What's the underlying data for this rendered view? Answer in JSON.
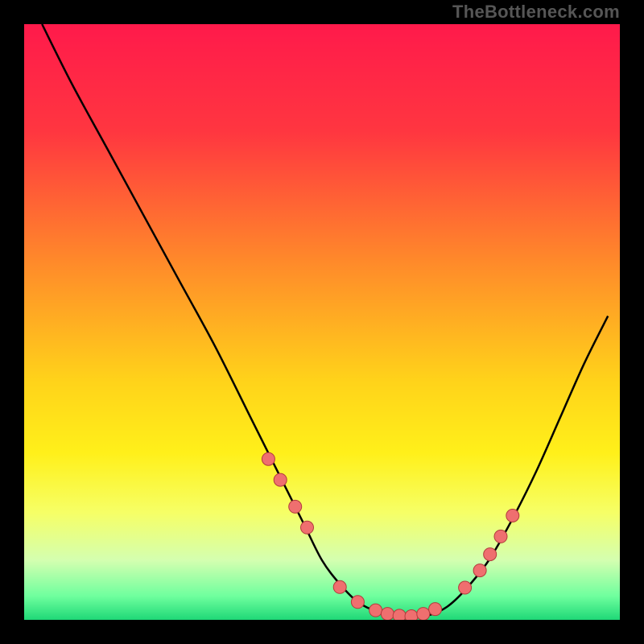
{
  "watermark": "TheBottleneck.com",
  "chart_data": {
    "type": "line",
    "title": "",
    "xlabel": "",
    "ylabel": "",
    "xlim": [
      0,
      100
    ],
    "ylim": [
      0,
      100
    ],
    "gradient_stops": [
      {
        "offset": 0,
        "color": "#ff1a4b"
      },
      {
        "offset": 18,
        "color": "#ff3640"
      },
      {
        "offset": 40,
        "color": "#ff8a2a"
      },
      {
        "offset": 60,
        "color": "#ffd31a"
      },
      {
        "offset": 72,
        "color": "#fff01a"
      },
      {
        "offset": 82,
        "color": "#f6ff66"
      },
      {
        "offset": 90,
        "color": "#d4ffb0"
      },
      {
        "offset": 96,
        "color": "#6fff9e"
      },
      {
        "offset": 100,
        "color": "#1fd877"
      }
    ],
    "curve": {
      "x": [
        3,
        8,
        14,
        20,
        26,
        32,
        38,
        43,
        47,
        50,
        53,
        56,
        59,
        62,
        65,
        68,
        71,
        74,
        78,
        82,
        86,
        90,
        94,
        98
      ],
      "y": [
        100,
        90,
        79,
        68,
        57,
        46,
        34,
        24,
        16,
        10,
        6,
        3,
        1.5,
        0.8,
        0.5,
        0.8,
        2.2,
        5,
        10,
        17,
        25,
        34,
        43,
        51
      ]
    },
    "markers": {
      "x": [
        41,
        43,
        45.5,
        47.5,
        53,
        56,
        59,
        61,
        63,
        65,
        67,
        69,
        74,
        76.5,
        78.2,
        80,
        82
      ],
      "y": [
        27,
        23.5,
        19,
        15.5,
        5.5,
        3,
        1.6,
        1.0,
        0.7,
        0.6,
        1.0,
        1.8,
        5.4,
        8.3,
        11,
        14,
        17.5
      ]
    },
    "marker_style": {
      "fill": "#ef6f6f",
      "stroke": "#b23c3c",
      "r": 8
    }
  }
}
